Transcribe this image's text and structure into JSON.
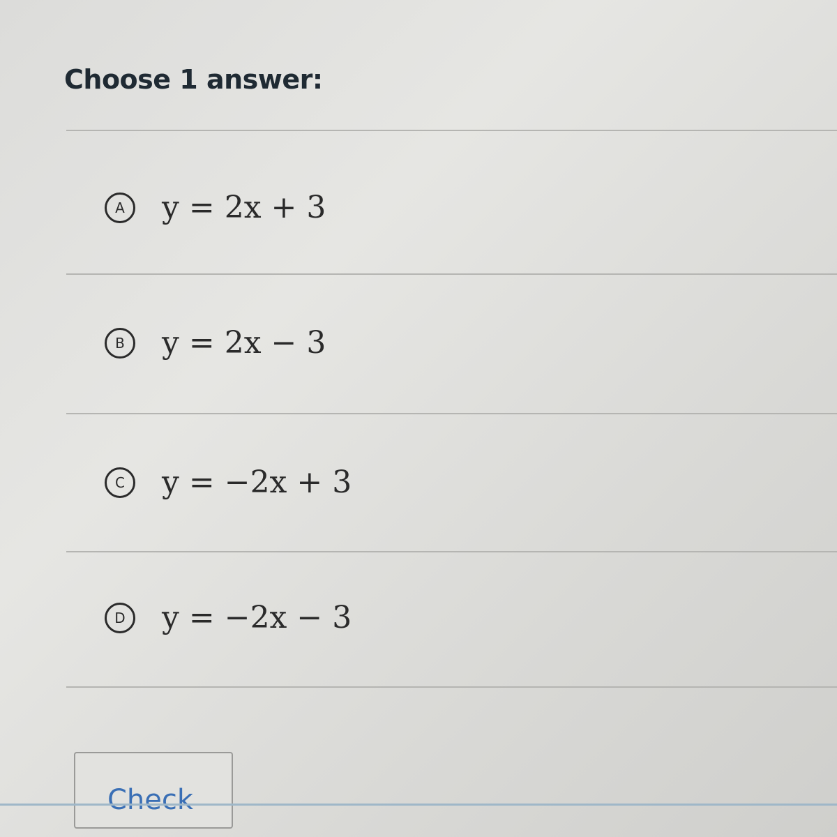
{
  "prompt": "Choose 1 answer:",
  "choices": [
    {
      "letter": "A",
      "equation": "y = 2x + 3"
    },
    {
      "letter": "B",
      "equation": "y = 2x − 3"
    },
    {
      "letter": "C",
      "equation": "y = −2x + 3"
    },
    {
      "letter": "D",
      "equation": "y = −2x − 3"
    }
  ],
  "check_label": "Check",
  "colors": {
    "text": "#1f2a33",
    "check_text": "#3a6fb5",
    "divider": "#b5b5b2"
  }
}
